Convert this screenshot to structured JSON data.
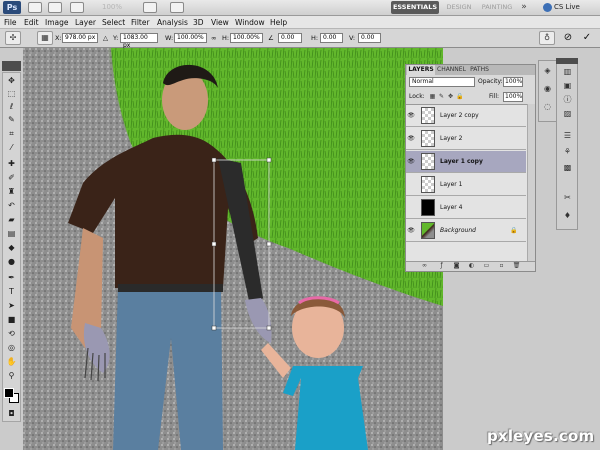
{
  "app": {
    "logo": "Ps",
    "zoom": "100%",
    "workspaces": [
      "ESSENTIALS",
      "DESIGN",
      "PAINTING"
    ],
    "workspace_more": "»",
    "cs_live": "CS Live"
  },
  "menu": [
    "File",
    "Edit",
    "Image",
    "Layer",
    "Select",
    "Filter",
    "Analysis",
    "3D",
    "View",
    "Window",
    "Help"
  ],
  "options": {
    "x_label": "X:",
    "x_value": "978.00 px",
    "y_label": "Y:",
    "y_value": "1083.00 px",
    "w_label": "W:",
    "w_value": "100.00%",
    "h_label": "H:",
    "h_value": "100.00%",
    "angle_value": "0.00",
    "hskew_label": "H:",
    "hskew_value": "0.00",
    "vskew_label": "V:",
    "vskew_value": "0.00",
    "cancel_icon": "⊘",
    "commit_icon": "✓"
  },
  "tools": [
    "move-icon",
    "marquee-icon",
    "lasso-icon",
    "quick-select-icon",
    "crop-icon",
    "eyedropper-icon",
    "healing-icon",
    "brush-icon",
    "clone-stamp-icon",
    "history-brush-icon",
    "eraser-icon",
    "gradient-icon",
    "blur-icon",
    "dodge-icon",
    "pen-icon",
    "type-icon",
    "path-select-icon",
    "shape-icon",
    "3d-rotate-icon",
    "3d-orbit-icon",
    "hand-icon",
    "zoom-icon"
  ],
  "layers_panel": {
    "tabs": [
      "LAYERS",
      "CHANNEL",
      "PATHS"
    ],
    "blend_mode": "Normal",
    "opacity_label": "Opacity:",
    "opacity_value": "100%",
    "lock_label": "Lock:",
    "fill_label": "Fill:",
    "fill_value": "100%",
    "layers": [
      {
        "name": "Layer 2 copy",
        "visible": true,
        "selected": false,
        "thumb": "transparent"
      },
      {
        "name": "Layer 2",
        "visible": true,
        "selected": false,
        "thumb": "transparent"
      },
      {
        "name": "Layer 1 copy",
        "visible": true,
        "selected": true,
        "thumb": "transparent"
      },
      {
        "name": "Layer 1",
        "visible": false,
        "selected": false,
        "thumb": "transparent"
      },
      {
        "name": "Layer 4",
        "visible": false,
        "selected": false,
        "thumb": "black"
      },
      {
        "name": "Background",
        "visible": true,
        "selected": false,
        "thumb": "photo"
      }
    ]
  },
  "watermark": "pxleyes.com",
  "colors": {
    "grass": "#5fb82a",
    "gravel": "#8a8a8a",
    "shirt": "#3a2318",
    "jeans": "#5a7fa0",
    "dress": "#1aa0c8"
  }
}
